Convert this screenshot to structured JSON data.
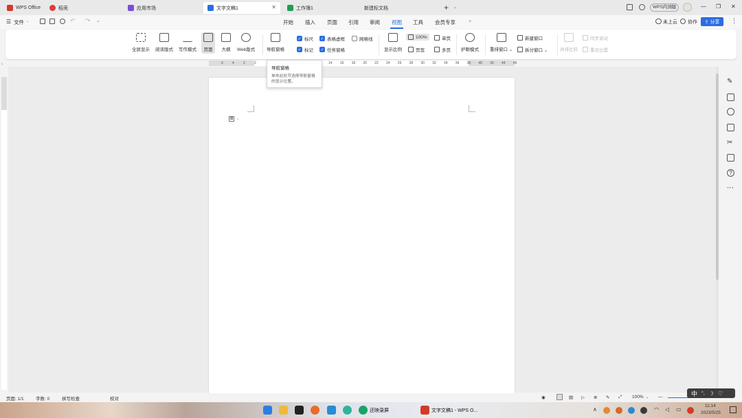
{
  "tabs": [
    {
      "label": "WPS Office",
      "color": "#d23a2a"
    },
    {
      "label": "稻壳",
      "color": "#e03c3c"
    },
    {
      "label": "应用市场",
      "color": "#7b4dd8"
    },
    {
      "label": "文字文稿1",
      "color": "#2b6de0"
    },
    {
      "label": "工作簿1",
      "color": "#1f9d55"
    },
    {
      "label": "新建标文档"
    }
  ],
  "window_right": {
    "beta_badge": "WPS内测版",
    "minimize": "—",
    "restore": "❐",
    "close": "✕"
  },
  "menubar": {
    "file_label": "文件",
    "items": [
      "开始",
      "插入",
      "页面",
      "引用",
      "审阅",
      "视图",
      "工具",
      "会员专享"
    ],
    "active": "视图",
    "cloud_label": "未上云",
    "collab_label": "协作",
    "share_label": "分享"
  },
  "ribbon": {
    "big_buttons": [
      "全屏显示",
      "阅读版式",
      "写作模式",
      "页面",
      "大纲",
      "Web版式",
      "导航窗格"
    ],
    "checkboxes": [
      {
        "label": "标尺",
        "checked": true
      },
      {
        "label": "表格虚框",
        "checked": true
      },
      {
        "label": "网格线",
        "checked": false
      },
      {
        "label": "标记",
        "checked": true
      },
      {
        "label": "任务窗格",
        "checked": true
      }
    ],
    "zoom_label": "显示比例",
    "zoom_value": "100%",
    "page_width_label": "页宽",
    "single_page_label": "单页",
    "multi_page_label": "多页",
    "eye_mode_label": "护眼模式",
    "rearrange_label": "重排窗口",
    "new_window_label": "新建窗口",
    "split_window_label": "拆分窗口",
    "side_by_side_label": "并排比较",
    "sync_scroll_label": "同步滚动",
    "reset_position_label": "重设位置"
  },
  "tooltip": {
    "title": "导航窗格",
    "body": "单击此处可选择导航窗格的显示位置。"
  },
  "ruler_ticks": [
    "6",
    "4",
    "2",
    "2",
    "14",
    "16",
    "18",
    "20",
    "22",
    "24",
    "26",
    "28",
    "30",
    "32",
    "34",
    "36",
    "38",
    "40",
    "42",
    "44",
    "46"
  ],
  "statusbar": {
    "page": "页面: 1/1",
    "words": "字数: 0",
    "spell": "拼写检查",
    "proof": "校对",
    "zoom": "100%"
  },
  "taskbar": {
    "app1_label": "还映录屏",
    "app2_label": "文字文稿1 - WPS O...",
    "time": "11:14",
    "date": "2023/5/25"
  },
  "ime": {
    "lang": "中"
  },
  "colors": {
    "accent": "#2b6de0",
    "share_bg": "#2b6de0"
  }
}
